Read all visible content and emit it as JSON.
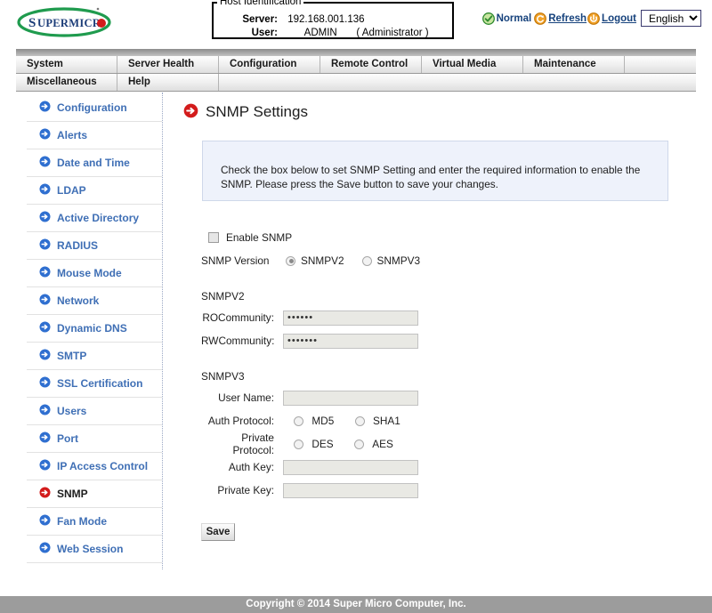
{
  "header": {
    "logo_main": "SUPERMICR",
    "logo_dot_icon": "red-dot-o",
    "host": {
      "legend": "Host Identification",
      "server_label": "Server:",
      "server_value": "192.168.001.136",
      "user_label": "User:",
      "user_value": "ADMIN",
      "user_role": "( Administrator )"
    },
    "status": {
      "health_icon": "green-check-icon",
      "health_label": "Normal",
      "refresh_icon": "refresh-icon",
      "refresh_label": "Refresh",
      "logout_icon": "logout-icon",
      "logout_label": "Logout",
      "language_selected": "English",
      "language_options": [
        "English"
      ]
    }
  },
  "nav": {
    "row1": [
      {
        "label": "System"
      },
      {
        "label": "Server Health"
      },
      {
        "label": "Configuration"
      },
      {
        "label": "Remote Control"
      },
      {
        "label": "Virtual Media"
      },
      {
        "label": "Maintenance"
      }
    ],
    "row2": [
      {
        "label": "Miscellaneous"
      },
      {
        "label": "Help"
      }
    ]
  },
  "sidebar": {
    "items": [
      {
        "label": "Configuration",
        "active": false
      },
      {
        "label": "Alerts",
        "active": false
      },
      {
        "label": "Date and Time",
        "active": false
      },
      {
        "label": "LDAP",
        "active": false
      },
      {
        "label": "Active Directory",
        "active": false
      },
      {
        "label": "RADIUS",
        "active": false
      },
      {
        "label": "Mouse Mode",
        "active": false
      },
      {
        "label": "Network",
        "active": false
      },
      {
        "label": "Dynamic DNS",
        "active": false
      },
      {
        "label": "SMTP",
        "active": false
      },
      {
        "label": "SSL Certification",
        "active": false
      },
      {
        "label": "Users",
        "active": false
      },
      {
        "label": "Port",
        "active": false
      },
      {
        "label": "IP Access Control",
        "active": false
      },
      {
        "label": "SNMP",
        "active": true
      },
      {
        "label": "Fan Mode",
        "active": false
      },
      {
        "label": "Web Session",
        "active": false
      }
    ]
  },
  "main": {
    "title": "SNMP Settings",
    "title_icon": "red-arrow-icon",
    "info_text": "Check the box below to set SNMP Setting and enter the required information to enable the SNMP. Please press the Save button to save your changes.",
    "enable_snmp_label": "Enable SNMP",
    "enable_snmp_checked": false,
    "version_label": "SNMP Version",
    "version_options": [
      {
        "label": "SNMPV2",
        "selected": true
      },
      {
        "label": "SNMPV3",
        "selected": false
      }
    ],
    "snmpv2": {
      "title": "SNMPV2",
      "ro_label": "ROCommunity:",
      "ro_value": "••••••",
      "rw_label": "RWCommunity:",
      "rw_value": "•••••••"
    },
    "snmpv3": {
      "title": "SNMPV3",
      "username_label": "User Name:",
      "username_value": "",
      "auth_protocol_label": "Auth Protocol:",
      "auth_options": [
        {
          "label": "MD5",
          "selected": false
        },
        {
          "label": "SHA1",
          "selected": false
        }
      ],
      "private_protocol_label": "Private Protocol:",
      "private_options": [
        {
          "label": "DES",
          "selected": false
        },
        {
          "label": "AES",
          "selected": false
        }
      ],
      "auth_key_label": "Auth Key:",
      "auth_key_value": "",
      "private_key_label": "Private Key:",
      "private_key_value": ""
    },
    "save_label": "Save"
  },
  "footer": {
    "copyright": "Copyright © 2014 Super Micro Computer, Inc."
  },
  "colors": {
    "sidebar_link": "#3f6fb5",
    "active_icon": "#d31b1b",
    "logo_green": "#1f9b4e",
    "logo_blue": "#1b3c78",
    "info_bg": "#eef2fb",
    "footer_bg": "#9c9c9c"
  }
}
